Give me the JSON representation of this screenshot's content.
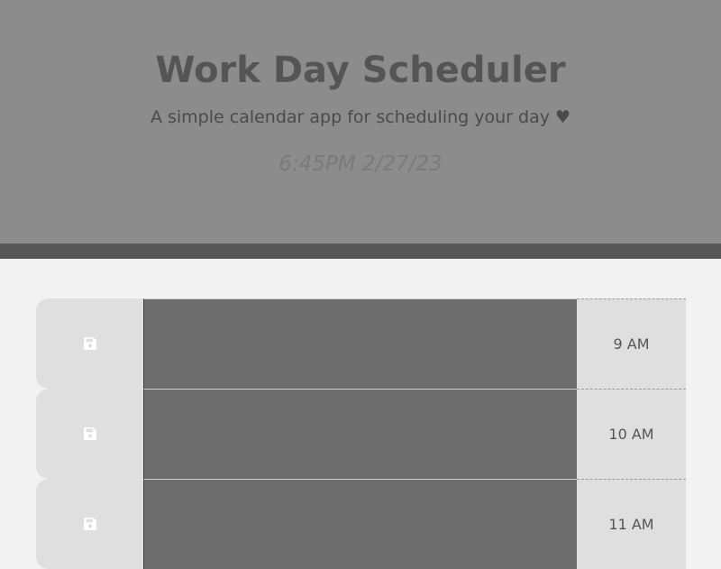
{
  "header": {
    "title": "Work Day Scheduler",
    "subtitle": "A simple calendar app for scheduling your day ♥",
    "current_datetime": "6:45PM 2/27/23"
  },
  "time_blocks": [
    {
      "hour": "9 AM",
      "description": "",
      "save_icon": "floppy-disk-icon"
    },
    {
      "hour": "10 AM",
      "description": "",
      "save_icon": "floppy-disk-icon"
    },
    {
      "hour": "11 AM",
      "description": "",
      "save_icon": "floppy-disk-icon"
    }
  ],
  "colors": {
    "header_bg": "#8c8c8c",
    "header_border": "#575757",
    "page_bg": "#f2f2f2",
    "block_bg": "#dfdfdf",
    "textarea_bg": "#6d6d6d",
    "text": "#555555"
  }
}
